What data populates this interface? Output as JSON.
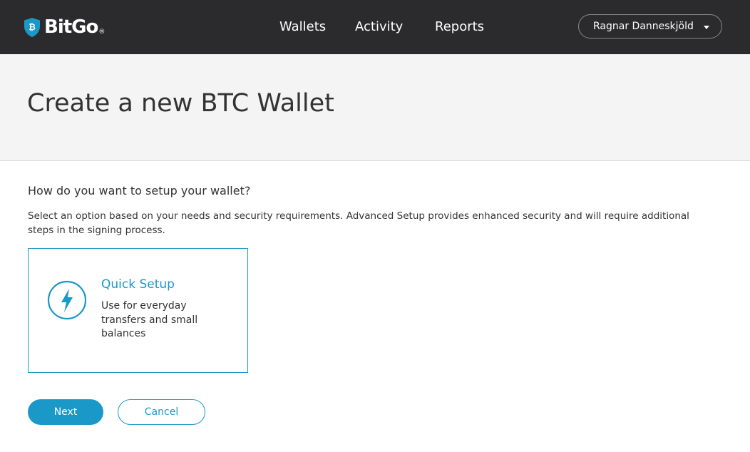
{
  "header": {
    "logo_text": "BitGo",
    "logo_reg": "®",
    "logo_icon": "bitgo-shield-bitcoin-icon",
    "nav": [
      {
        "label": "Wallets"
      },
      {
        "label": "Activity"
      },
      {
        "label": "Reports"
      }
    ],
    "user_name": "Ragnar Danneskjöld"
  },
  "banner": {
    "title": "Create a new BTC Wallet"
  },
  "main": {
    "question": "How do you want to setup your wallet?",
    "description": "Select an option based on your needs and security requirements. Advanced Setup provides enhanced security and will require additional steps in the signing process.",
    "options": [
      {
        "icon": "lightning-bolt-icon",
        "title": "Quick Setup",
        "description": "Use for everyday transfers and small balances"
      }
    ],
    "next_label": "Next",
    "cancel_label": "Cancel"
  },
  "colors": {
    "accent": "#1a98c7",
    "topbar": "#2b2b2d",
    "banner": "#f4f4f4"
  }
}
